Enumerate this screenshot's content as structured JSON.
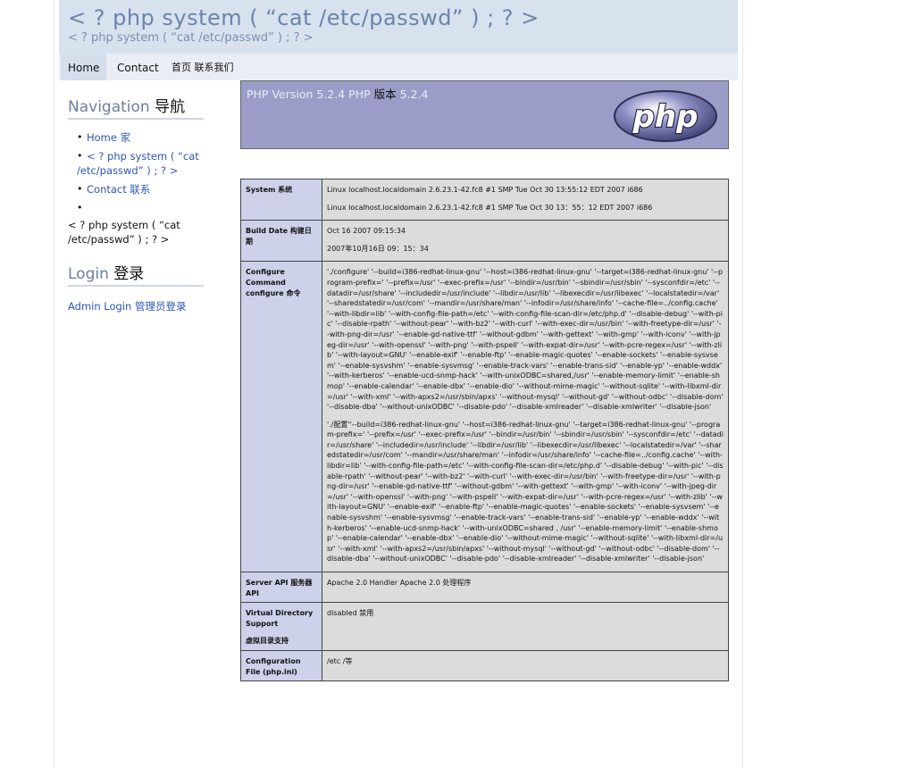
{
  "header": {
    "title": "< ? php system ( “cat /etc/passwd” ) ; ? >",
    "subtitle": "< ? php system ( “cat /etc/passwd” ) ; ? >"
  },
  "topnav": {
    "home": "Home",
    "contact": "Contact",
    "extra": "首页 联系我们"
  },
  "sidebar": {
    "nav_heading": "Navigation",
    "nav_heading_cjk": "导航",
    "items": [
      {
        "label": "Home 家"
      },
      {
        "label": "< ? php system ( “cat /etc/passwd” ) ; ? >"
      },
      {
        "label": "Contact 联系"
      },
      {
        "label": ""
      }
    ],
    "extra_text": "< ? php system ( “cat /etc/passwd” ) ; ? >",
    "login_heading": "Login",
    "login_heading_cjk": "登录",
    "admin_link": "Admin Login 管理员登录"
  },
  "banner": {
    "version": "PHP Version 5.2.4 PHP",
    "version_cjk": "版本",
    "version_num": "5.2.4",
    "logo_text": "php"
  },
  "info_rows": [
    {
      "key": "System 系统",
      "key_sub": "",
      "values": [
        "Linux localhost.localdomain 2.6.23.1-42.fc8 #1 SMP Tue Oct 30 13:55:12 EDT 2007 i686",
        "Linux localhost.localdomain 2.6.23.1-42.fc8 #1 SMP Tue Oct 30 13：55：12 EDT 2007 i686"
      ]
    },
    {
      "key": "Build Date 构建日期",
      "key_sub": "",
      "values": [
        "Oct 16 2007 09:15:34",
        "2007年10月16日 09：15：34"
      ]
    },
    {
      "key": "Configure Command  configure 命令",
      "key_sub": "",
      "values": [
        "'./configure' '--build=i386-redhat-linux-gnu' '--host=i386-redhat-linux-gnu' '--target=i386-redhat-linux-gnu' '--program-prefix=' '--prefix=/usr' '--exec-prefix=/usr' '--bindir=/usr/bin' '--sbindir=/usr/sbin' '--sysconfdir=/etc' '--datadir=/usr/share' '--includedir=/usr/include' '--libdir=/usr/lib' '--libexecdir=/usr/libexec' '--localstatedir=/var' '--sharedstatedir=/usr/com' '--mandir=/usr/share/man' '--infodir=/usr/share/info' '--cache-file=../config.cache' '--with-libdir=lib' '--with-config-file-path=/etc' '--with-config-file-scan-dir=/etc/php.d' '--disable-debug' '--with-pic' '--disable-rpath' '--without-pear' '--with-bz2' '--with-curl' '--with-exec-dir=/usr/bin' '--with-freetype-dir=/usr' '--with-png-dir=/usr' '--enable-gd-native-ttf' '--without-gdbm' '--with-gettext' '--with-gmp' '--with-iconv' '--with-jpeg-dir=/usr' '--with-openssl' '--with-png' '--with-pspell' '--with-expat-dir=/usr' '--with-pcre-regex=/usr' '--with-zlib' '--with-layout=GNU' '--enable-exif' '--enable-ftp' '--enable-magic-quotes' '--enable-sockets' '--enable-sysvsem' '--enable-sysvshm' '--enable-sysvmsg' '--enable-track-vars' '--enable-trans-sid' '--enable-yp' '--enable-wddx' '--with-kerberos' '--enable-ucd-snmp-hack' '--with-unixODBC=shared,/usr' '--enable-memory-limit' '--enable-shmop' '--enable-calendar' '--enable-dbx' '--enable-dio' '--without-mime-magic' '--without-sqlite' '--with-libxml-dir=/usr' '--with-xml' '--with-apxs2=/usr/sbin/apxs' '--without-mysql' '--without-gd' '--without-odbc' '--disable-dom' '--disable-dba' '--without-unixODBC' '--disable-pdo' '--disable-xmlreader' '--disable-xmlwriter' '--disable-json'",
        "'./配置''--build=i386-redhat-linux-gnu' '--host=i386-redhat-linux-gnu' '--target=i386-redhat-linux-gnu' '--program-prefix=' '--prefix=/usr' '--exec-prefix=/usr' '--bindir=/usr/bin' '--sbindir=/usr/sbin' '--sysconfdir=/etc' '--datadir=/usr/share' '--includedir=/usr/include' '--libdir=/usr/lib' '--libexecdir=/usr/libexec' '--localstatedir=/var' '--sharedstatedir=/usr/com' '--mandir=/usr/share/man' '--infodir=/usr/share/info' '--cache-file=../config.cache' '--with-libdir=lib' '--with-config-file-path=/etc' '--with-config-file-scan-dir=/etc/php.d' '--disable-debug' '--with-pic' '--disable-rpath' '--without-pear' '--with-bz2' '--with-curl' '--with-exec-dir=/usr/bin' '--with-freetype-dir=/usr' '--with-png-dir=/usr' '--enable-gd-native-ttf' '--without-gdbm' '--with-gettext' '--with-gmp' '--with-iconv' '--with-jpeg-dir=/usr' '--with-openssl' '--with-png' '--with-pspell' '--with-expat-dir=/usr' '--with-pcre-regex=/usr' '--with-zlib' '--with-layout=GNU' '--enable-exif' '--enable-ftp' '--enable-magic-quotes' '--enable-sockets' '--enable-sysvsem' '--enable-sysvshm' '--enable-sysvmsg' '--enable-track-vars' '--enable-trans-sid' '--enable-yp' '--enable-wddx' '--with-kerberos' '--enable-ucd-snmp-hack' '--with-unixODBC=shared , /usr' '--enable-memory-limit' '--enable-shmop' '--enable-calendar' '--enable-dbx' '--enable-dio' '--without-mime-magic' '--without-sqlite' '--with-libxml-dir=/usr' '--with-xml' '--with-apxs2=/usr/sbin/apxs' '--without-mysql' '--without-gd' '--without-odbc' '--disable-dom' '--disable-dba' '--without-unixODBC' '--disable-pdo' '--disable-xmlreader' '--disable-xmlwriter' '--disable-json'"
      ]
    },
    {
      "key": "Server API 服务器 API",
      "key_sub": "",
      "values": [
        "Apache 2.0 Handler  Apache 2.0 处理程序"
      ]
    },
    {
      "key": "Virtual Directory Support",
      "key_sub": "虚拟目录支持",
      "values": [
        "disabled  禁用"
      ]
    },
    {
      "key": "Configuration File (php.ini)",
      "key_sub": "",
      "values": [
        "/etc  /等"
      ]
    }
  ]
}
